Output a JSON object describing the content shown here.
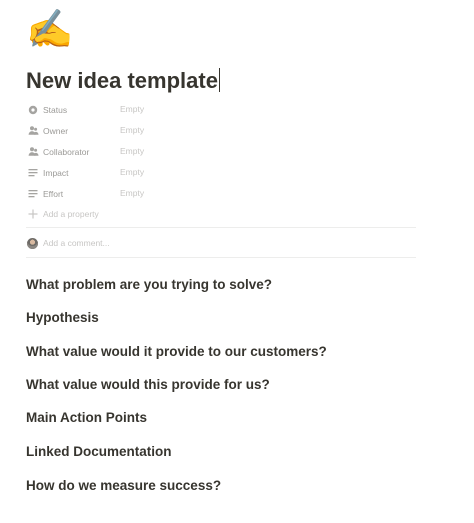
{
  "page": {
    "emoji": "✍️",
    "title": "New idea template",
    "properties": [
      {
        "icon": "status-icon",
        "label": "Status",
        "value": "Empty"
      },
      {
        "icon": "person-icon",
        "label": "Owner",
        "value": "Empty"
      },
      {
        "icon": "person-icon",
        "label": "Collaborator",
        "value": "Empty"
      },
      {
        "icon": "text-lines-icon",
        "label": "Impact",
        "value": "Empty"
      },
      {
        "icon": "text-lines-icon",
        "label": "Effort",
        "value": "Empty"
      }
    ],
    "add_property_label": "Add a property",
    "comment_placeholder": "Add a comment...",
    "headings": [
      "What problem are you trying to solve?",
      "Hypothesis",
      "What value would it provide to our customers?",
      "What value would this provide for us?",
      "Main Action Points",
      "Linked Documentation",
      "How do we measure success?"
    ]
  }
}
